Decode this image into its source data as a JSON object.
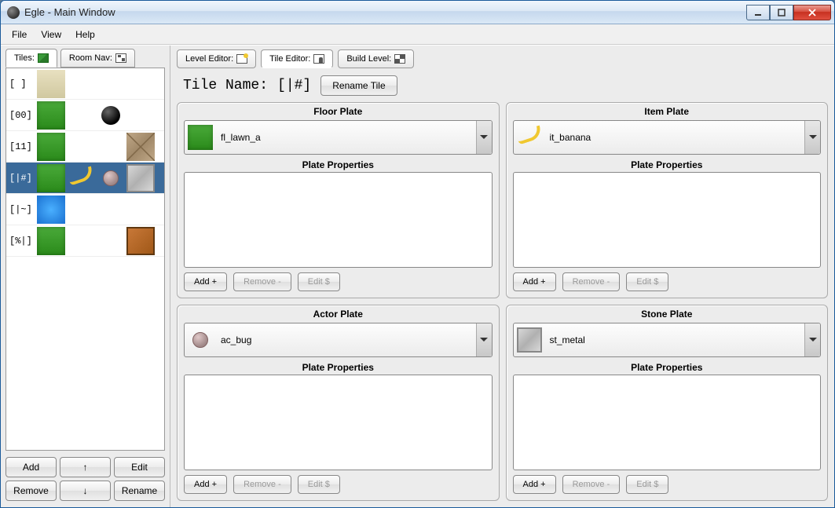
{
  "window": {
    "title": "Egle - Main Window"
  },
  "menu": {
    "file": "File",
    "view": "View",
    "help": "Help"
  },
  "sidebar": {
    "tabs": {
      "tiles": "Tiles:",
      "roomnav": "Room Nav:"
    },
    "rows": [
      {
        "code": "[  ]"
      },
      {
        "code": "[00]"
      },
      {
        "code": "[11]"
      },
      {
        "code": "[|#]"
      },
      {
        "code": "[|~]"
      },
      {
        "code": "[%|]"
      }
    ],
    "buttons": {
      "add": "Add",
      "up": "↑",
      "edit": "Edit",
      "remove": "Remove",
      "down": "↓",
      "rename": "Rename"
    }
  },
  "topTabs": {
    "level": "Level Editor:",
    "tile": "Tile Editor:",
    "build": "Build Level:"
  },
  "nameRow": {
    "label": "Tile Name:",
    "value": "[|#]",
    "rename": "Rename Tile"
  },
  "plates": {
    "floor": {
      "title": "Floor Plate",
      "value": "fl_lawn_a"
    },
    "item": {
      "title": "Item Plate",
      "value": "it_banana"
    },
    "actor": {
      "title": "Actor Plate",
      "value": "ac_bug"
    },
    "stone": {
      "title": "Stone Plate",
      "value": "st_metal"
    },
    "props": "Plate Properties",
    "add": "Add +",
    "remove": "Remove -",
    "edit": "Edit $"
  }
}
